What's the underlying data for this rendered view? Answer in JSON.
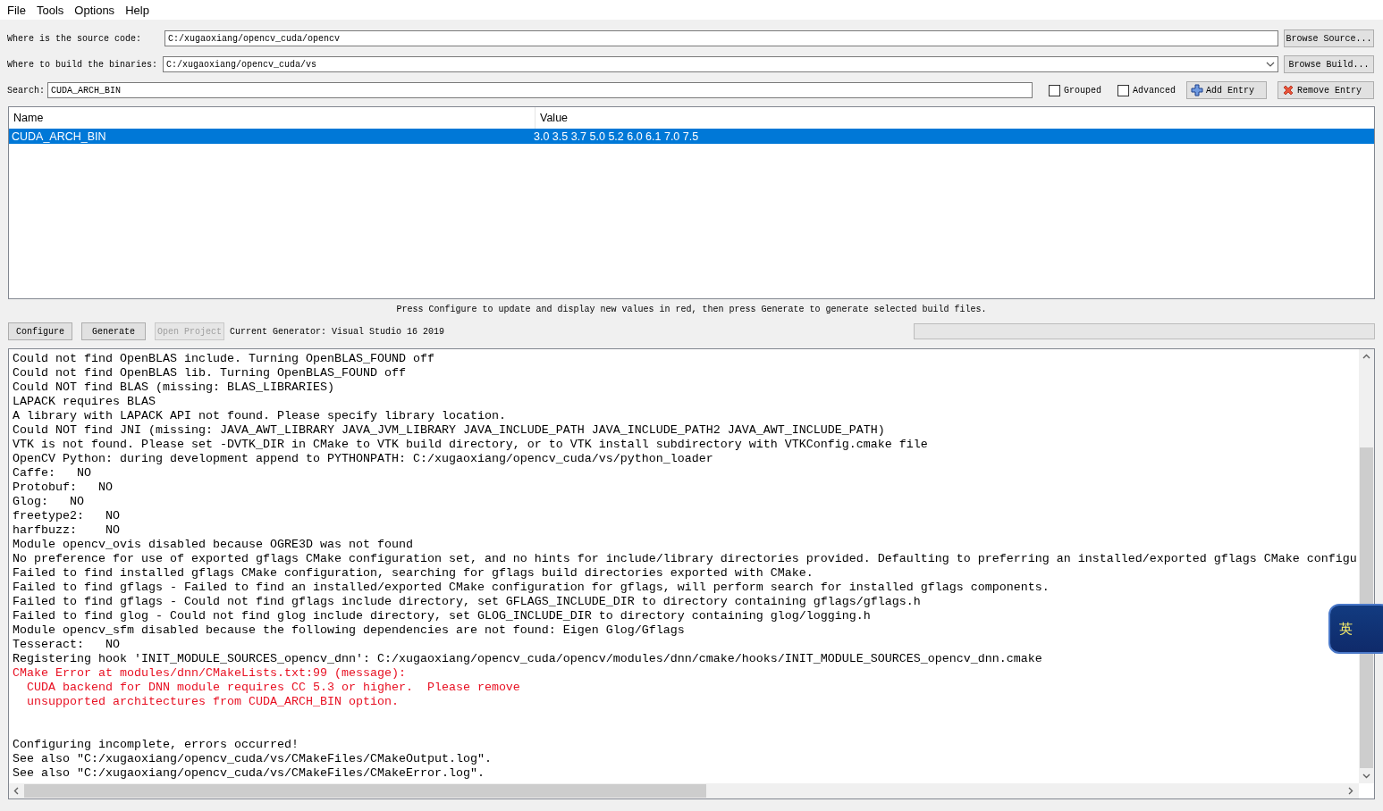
{
  "menu": [
    {
      "label": "File"
    },
    {
      "label": "Tools"
    },
    {
      "label": "Options"
    },
    {
      "label": "Help"
    }
  ],
  "source": {
    "label": "Where is the source code:",
    "value": "C:/xugaoxiang/opencv_cuda/opencv",
    "button": "Browse Source..."
  },
  "build": {
    "label": "Where to build the binaries:",
    "value": "C:/xugaoxiang/opencv_cuda/vs",
    "button": "Browse Build..."
  },
  "search": {
    "label": "Search:",
    "value": "CUDA_ARCH_BIN"
  },
  "options": [
    {
      "label": "Grouped",
      "checked": false
    },
    {
      "label": "Advanced",
      "checked": false
    }
  ],
  "entry_buttons": [
    {
      "label": "Add Entry",
      "kind": "add"
    },
    {
      "label": "Remove Entry",
      "kind": "remove"
    }
  ],
  "table": {
    "columns": [
      "Name",
      "Value"
    ],
    "rows": [
      {
        "cells": [
          "CUDA_ARCH_BIN",
          "3.0 3.5 3.7 5.0 5.2 6.0 6.1 7.0 7.5"
        ],
        "selected": true
      }
    ]
  },
  "hint": "Press Configure to update and display new values in red, then press Generate to generate selected build files.",
  "actions": [
    {
      "label": "Configure",
      "disabled": false
    },
    {
      "label": "Generate",
      "disabled": false
    },
    {
      "label": "Open Project",
      "disabled": true
    }
  ],
  "generator": "Current Generator: Visual Studio 16 2019",
  "progress": {
    "level": 0
  },
  "log": [
    {
      "text": "Could not find OpenBLAS include. Turning OpenBLAS_FOUND off",
      "kind": "info"
    },
    {
      "text": "Could not find OpenBLAS lib. Turning OpenBLAS_FOUND off",
      "kind": "info"
    },
    {
      "text": "Could NOT find BLAS (missing: BLAS_LIBRARIES)",
      "kind": "info"
    },
    {
      "text": "LAPACK requires BLAS",
      "kind": "info"
    },
    {
      "text": "A library with LAPACK API not found. Please specify library location.",
      "kind": "info"
    },
    {
      "text": "Could NOT find JNI (missing: JAVA_AWT_LIBRARY JAVA_JVM_LIBRARY JAVA_INCLUDE_PATH JAVA_INCLUDE_PATH2 JAVA_AWT_INCLUDE_PATH)",
      "kind": "info"
    },
    {
      "text": "VTK is not found. Please set -DVTK_DIR in CMake to VTK build directory, or to VTK install subdirectory with VTKConfig.cmake file",
      "kind": "info"
    },
    {
      "text": "OpenCV Python: during development append to PYTHONPATH: C:/xugaoxiang/opencv_cuda/vs/python_loader",
      "kind": "info"
    },
    {
      "text": "Caffe:   NO",
      "kind": "info"
    },
    {
      "text": "Protobuf:   NO",
      "kind": "info"
    },
    {
      "text": "Glog:   NO",
      "kind": "info"
    },
    {
      "text": "freetype2:   NO",
      "kind": "info"
    },
    {
      "text": "harfbuzz:    NO",
      "kind": "info"
    },
    {
      "text": "Module opencv_ovis disabled because OGRE3D was not found",
      "kind": "info"
    },
    {
      "text": "No preference for use of exported gflags CMake configuration set, and no hints for include/library directories provided. Defaulting to preferring an installed/exported gflags CMake configu",
      "kind": "info"
    },
    {
      "text": "Failed to find installed gflags CMake configuration, searching for gflags build directories exported with CMake.",
      "kind": "info"
    },
    {
      "text": "Failed to find gflags - Failed to find an installed/exported CMake configuration for gflags, will perform search for installed gflags components.",
      "kind": "info"
    },
    {
      "text": "Failed to find gflags - Could not find gflags include directory, set GFLAGS_INCLUDE_DIR to directory containing gflags/gflags.h",
      "kind": "info"
    },
    {
      "text": "Failed to find glog - Could not find glog include directory, set GLOG_INCLUDE_DIR to directory containing glog/logging.h",
      "kind": "info"
    },
    {
      "text": "Module opencv_sfm disabled because the following dependencies are not found: Eigen Glog/Gflags",
      "kind": "info"
    },
    {
      "text": "Tesseract:   NO",
      "kind": "info"
    },
    {
      "text": "Registering hook 'INIT_MODULE_SOURCES_opencv_dnn': C:/xugaoxiang/opencv_cuda/opencv/modules/dnn/cmake/hooks/INIT_MODULE_SOURCES_opencv_dnn.cmake",
      "kind": "info"
    },
    {
      "text": "CMake Error at modules/dnn/CMakeLists.txt:99 (message):",
      "kind": "error"
    },
    {
      "text": "  CUDA backend for DNN module requires CC 5.3 or higher.  Please remove",
      "kind": "error"
    },
    {
      "text": "  unsupported architectures from CUDA_ARCH_BIN option.",
      "kind": "error"
    },
    {
      "text": "Configuring incomplete, errors occurred!",
      "kind": "info",
      "spaced": true
    },
    {
      "text": "See also \"C:/xugaoxiang/opencv_cuda/vs/CMakeFiles/CMakeOutput.log\".",
      "kind": "info"
    },
    {
      "text": "See also \"C:/xugaoxiang/opencv_cuda/vs/CMakeFiles/CMakeError.log\".",
      "kind": "info"
    }
  ],
  "ime": {
    "label": "英"
  }
}
